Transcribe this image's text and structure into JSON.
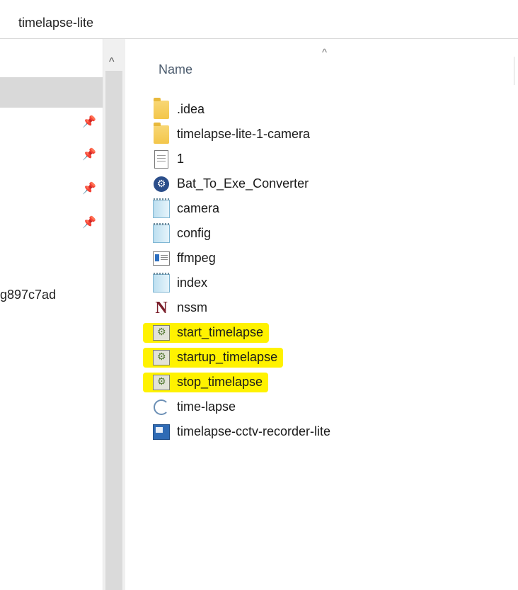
{
  "window": {
    "breadcrumb": "timelapse-lite"
  },
  "nav": {
    "partial_item": "g897c7ad",
    "pin_icon": "pin-icon",
    "scroll_up_icon": "^"
  },
  "list": {
    "column_header": "Name",
    "sort_indicator": "^",
    "items": [
      {
        "name": ".idea",
        "icon": "folder-icon",
        "highlighted": false
      },
      {
        "name": "timelapse-lite-1-camera",
        "icon": "folder-icon",
        "highlighted": false
      },
      {
        "name": "1",
        "icon": "text-document-icon",
        "highlighted": false
      },
      {
        "name": "Bat_To_Exe_Converter",
        "icon": "gear-app-icon",
        "highlighted": false
      },
      {
        "name": "camera",
        "icon": "notepad-icon",
        "highlighted": false
      },
      {
        "name": "config",
        "icon": "notepad-icon",
        "highlighted": false
      },
      {
        "name": "ffmpeg",
        "icon": "exe-window-icon",
        "highlighted": false
      },
      {
        "name": "index",
        "icon": "notepad-icon",
        "highlighted": false
      },
      {
        "name": "nssm",
        "icon": "nssm-icon",
        "highlighted": false
      },
      {
        "name": "start_timelapse",
        "icon": "batch-file-icon",
        "highlighted": true
      },
      {
        "name": "startup_timelapse",
        "icon": "batch-file-icon",
        "highlighted": true
      },
      {
        "name": "stop_timelapse",
        "icon": "batch-file-icon",
        "highlighted": true
      },
      {
        "name": "time-lapse",
        "icon": "timer-icon",
        "highlighted": false
      },
      {
        "name": "timelapse-cctv-recorder-lite",
        "icon": "application-icon",
        "highlighted": false
      }
    ]
  },
  "colors": {
    "highlight": "#fff200",
    "header_text": "#4b5b6d",
    "nav_selected": "#d9d9d9"
  }
}
